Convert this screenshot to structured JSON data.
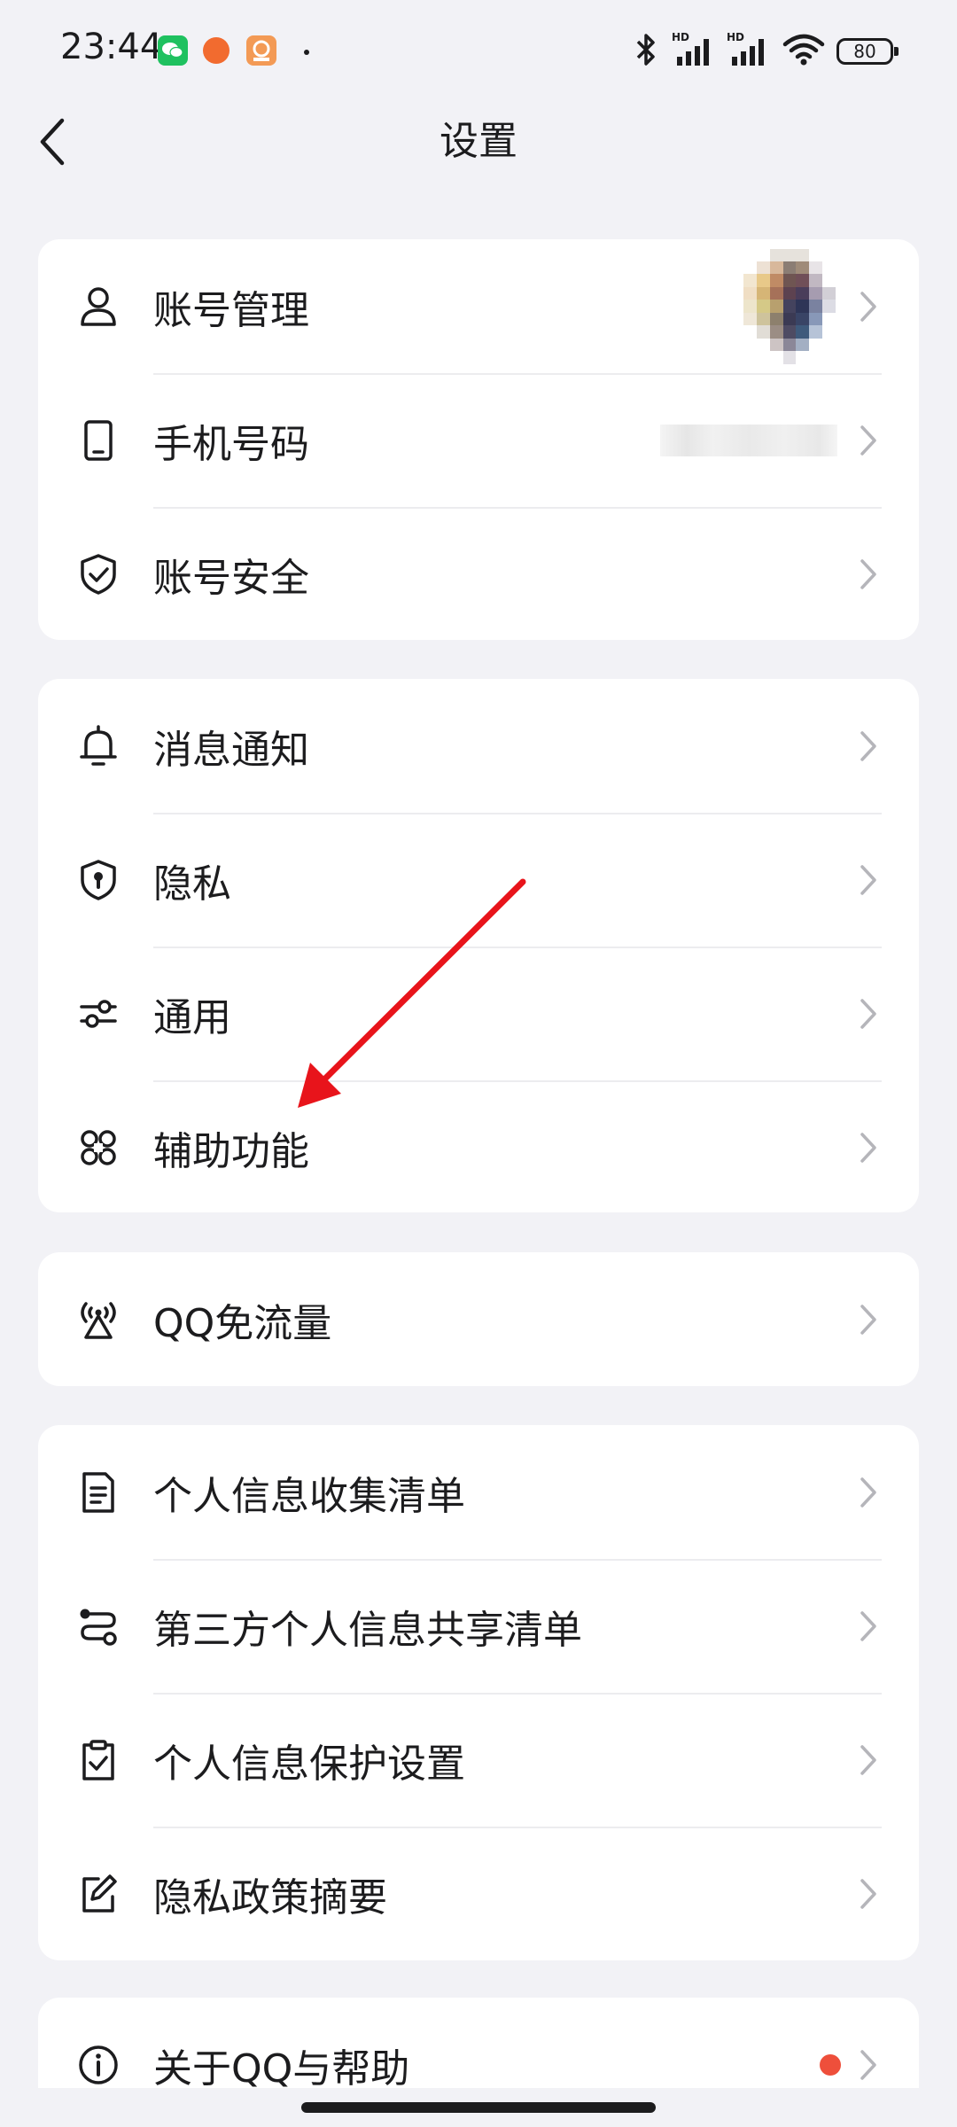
{
  "status_bar": {
    "time": "23:44",
    "battery": "80"
  },
  "header": {
    "title": "设置"
  },
  "groups": [
    {
      "items": [
        {
          "label": "账号管理",
          "icon": "user-icon"
        },
        {
          "label": "手机号码",
          "icon": "phone-icon"
        },
        {
          "label": "账号安全",
          "icon": "shield-check-icon"
        }
      ]
    },
    {
      "items": [
        {
          "label": "消息通知",
          "icon": "bell-icon"
        },
        {
          "label": "隐私",
          "icon": "privacy-shield-icon"
        },
        {
          "label": "通用",
          "icon": "sliders-icon"
        },
        {
          "label": "辅助功能",
          "icon": "command-icon"
        }
      ]
    },
    {
      "items": [
        {
          "label": "QQ免流量",
          "icon": "signal-tower-icon"
        }
      ]
    },
    {
      "items": [
        {
          "label": "个人信息收集清单",
          "icon": "document-list-icon"
        },
        {
          "label": "第三方个人信息共享清单",
          "icon": "share-route-icon"
        },
        {
          "label": "个人信息保护设置",
          "icon": "checklist-icon"
        },
        {
          "label": "隐私政策摘要",
          "icon": "edit-icon"
        }
      ]
    },
    {
      "items": [
        {
          "label": "关于QQ与帮助",
          "icon": "info-icon"
        }
      ]
    }
  ],
  "colors": {
    "background": "#f2f2f6",
    "card": "#ffffff",
    "text": "#1c1c1e",
    "chevron": "#b5b5ba",
    "badge": "#ee4f3b",
    "annotation_arrow": "#e8141b"
  }
}
